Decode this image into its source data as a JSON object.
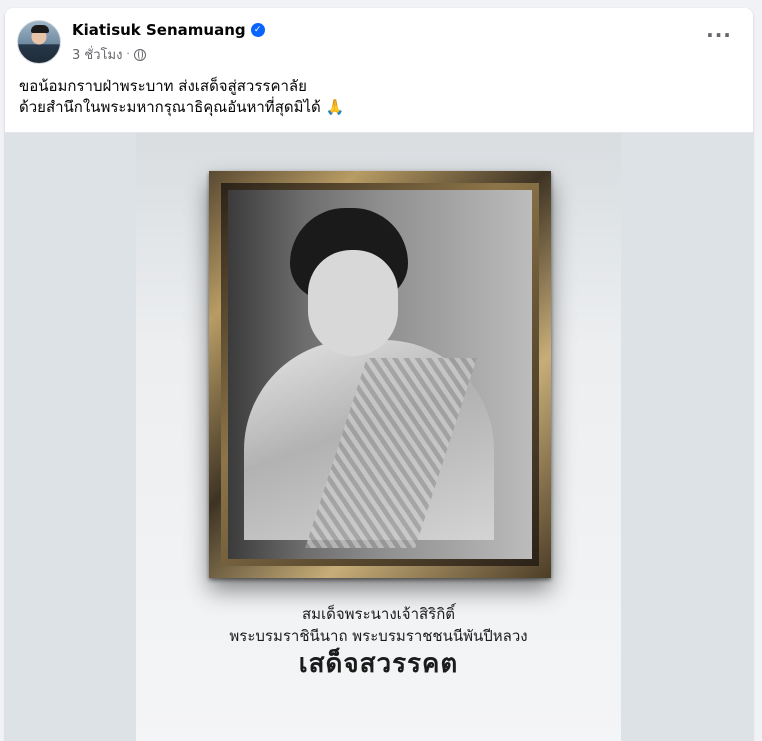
{
  "post": {
    "author": "Kiatisuk Senamuang",
    "time": "3 ชั่วโมง",
    "text_line1": "ขอน้อมกราบฝ่าพระบาท ส่งเสด็จสู่สวรรคาลัย",
    "text_line2": "ด้วยสำนึกในพระมหากรุณาธิคุณอันหาที่สุดมิได้ 🙏",
    "more_label": "···"
  },
  "image": {
    "caption_line1": "สมเด็จพระนางเจ้าสิริกิติ์",
    "caption_line2": "พระบรมราชินีนาถ พระบรมราชชนนีพันปีหลวง",
    "caption_line3": "เสด็จสวรรคต"
  },
  "colors": {
    "verified": "#0866ff",
    "background": "#f0f2f5",
    "meta_text": "#65676b"
  },
  "icons": [
    "verified-icon",
    "globe-icon",
    "more-options-icon"
  ]
}
